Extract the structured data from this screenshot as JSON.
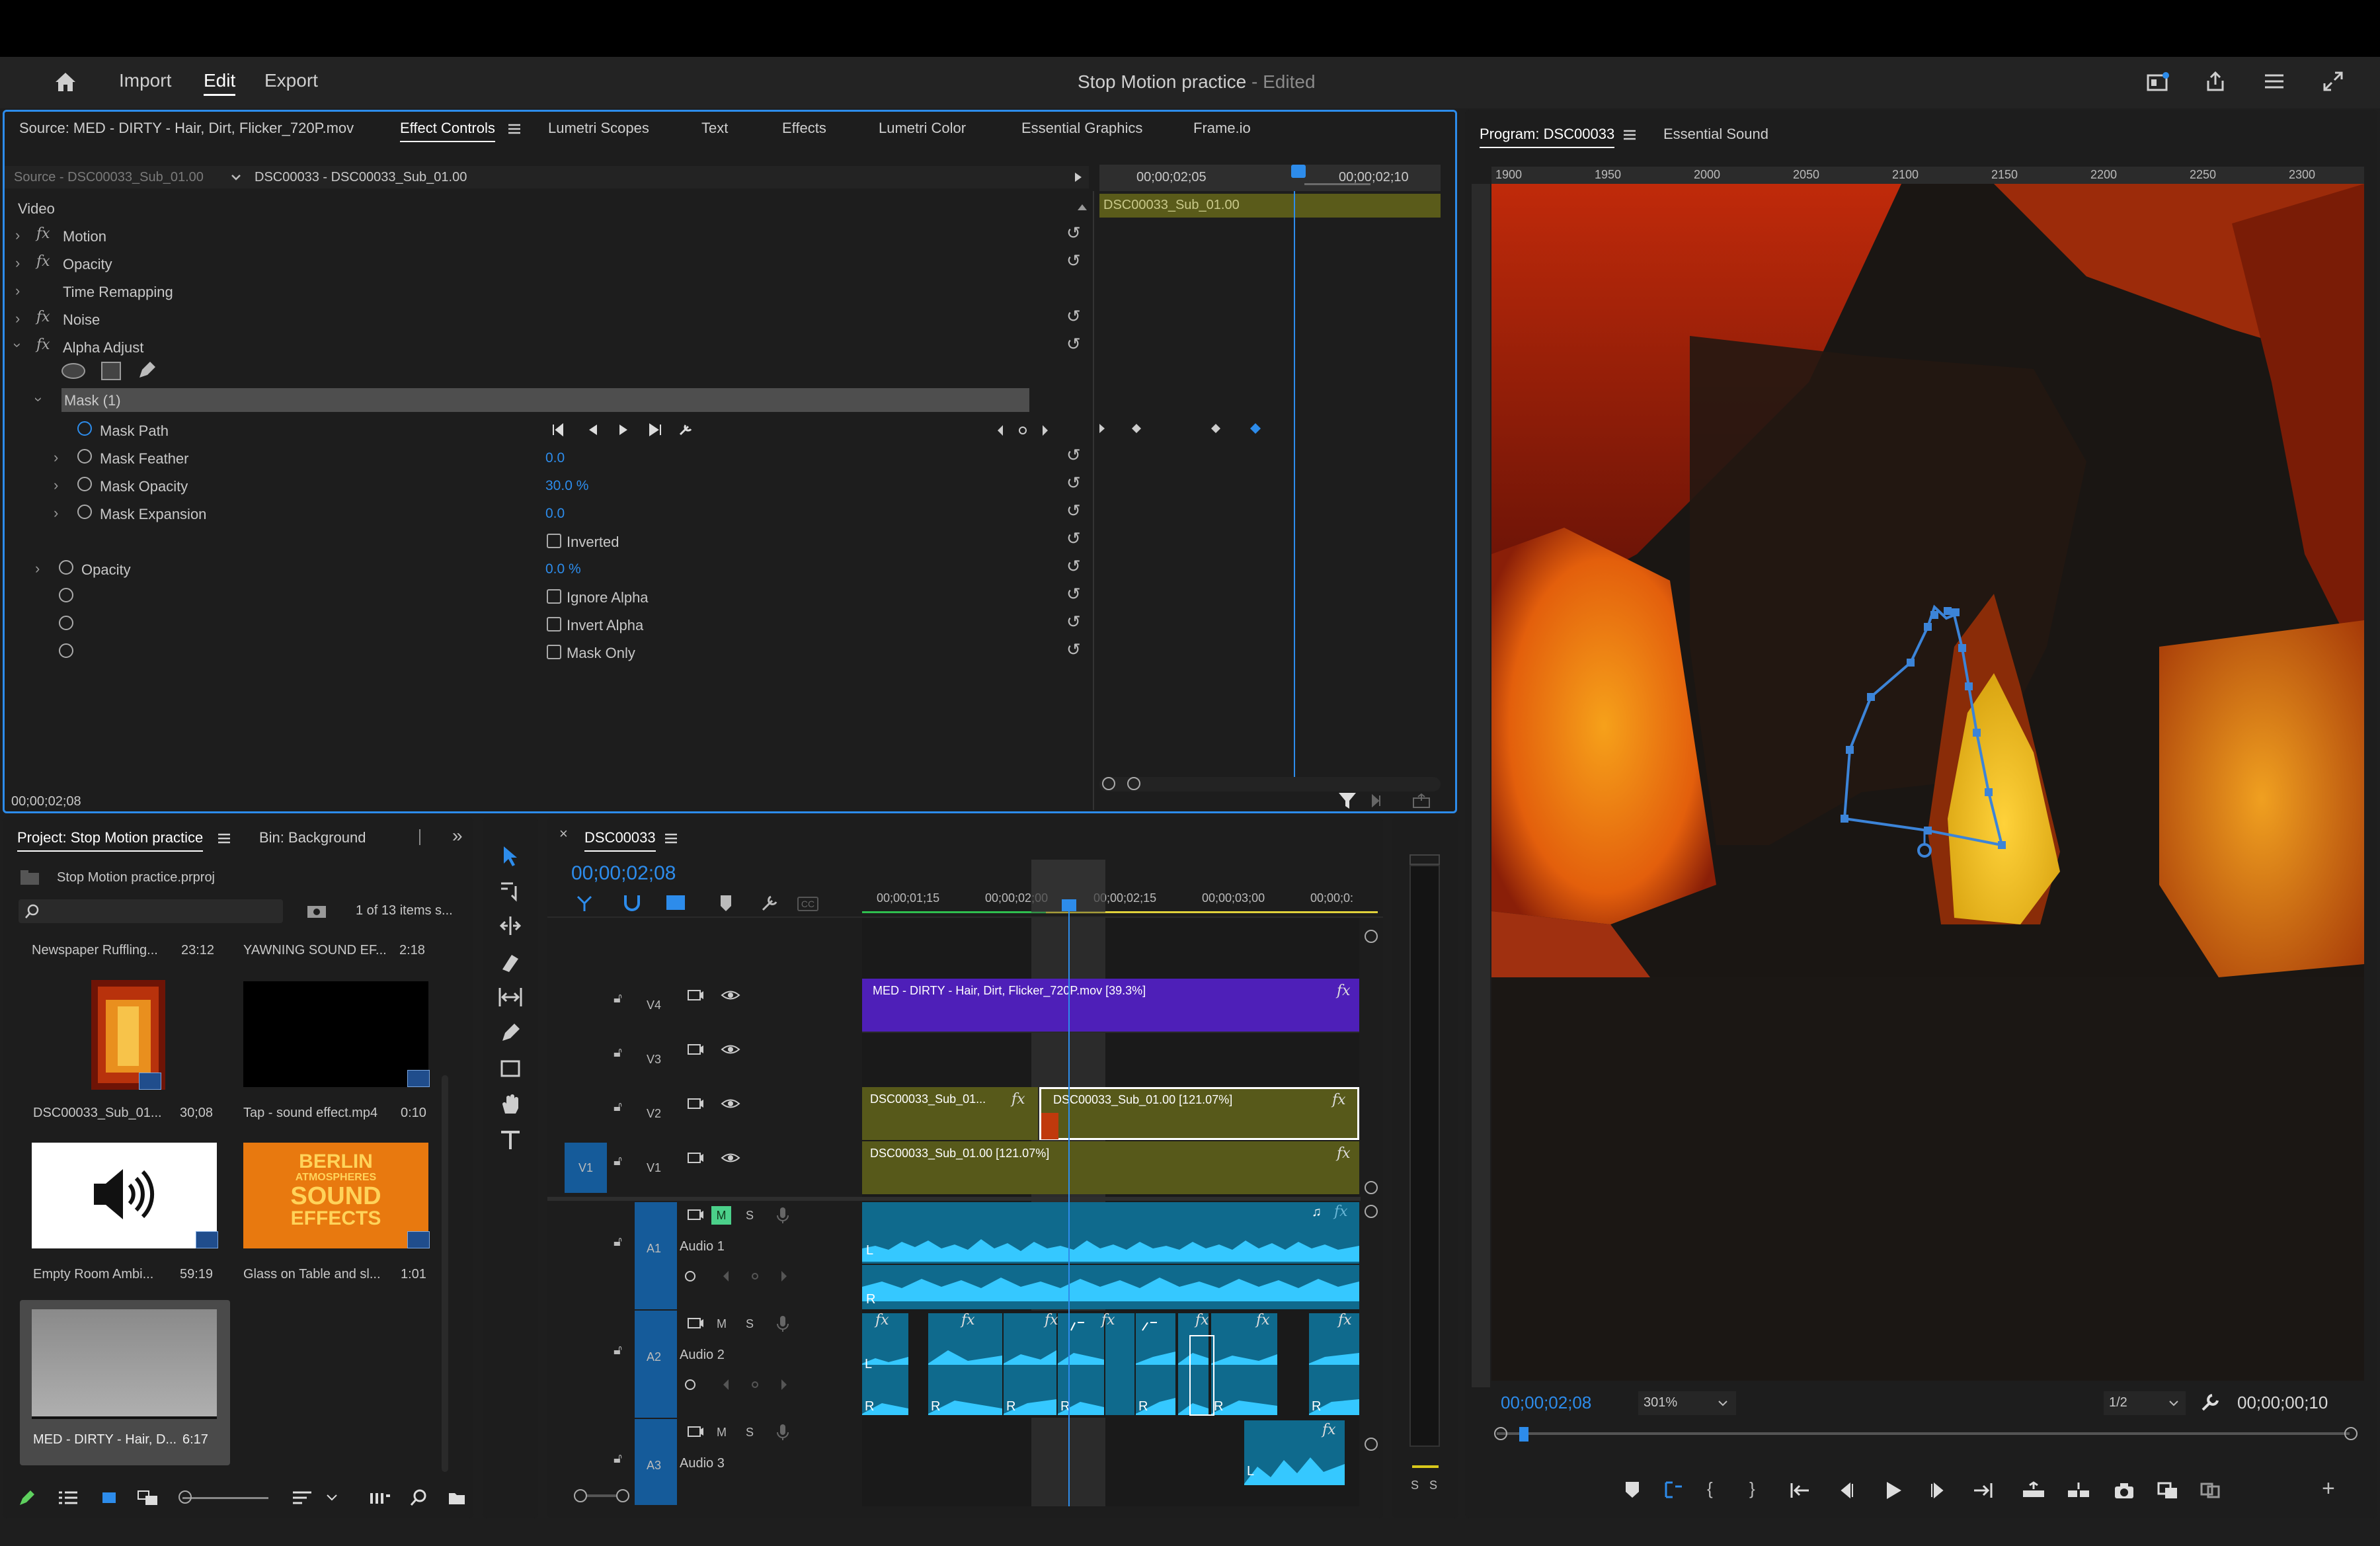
{
  "window": {
    "title": "Stop Motion practice",
    "title_status": "- Edited"
  },
  "menu": {
    "home_icon": "home-icon",
    "import": "Import",
    "edit": "Edit",
    "export": "Export"
  },
  "effect_panel": {
    "tabs": [
      "Source: MED - DIRTY - Hair, Dirt, Flicker_720P.mov",
      "Effect Controls",
      "Lumetri Scopes",
      "Text",
      "Effects",
      "Lumetri Color",
      "Essential Graphics",
      "Frame.io"
    ],
    "source_label": "Source - DSC00033_Sub_01.00",
    "sequence_clip": "DSC00033 - DSC00033_Sub_01.00",
    "mini_times": [
      "00;00;02;05",
      "00;00;02;10"
    ],
    "mini_clip": "DSC00033_Sub_01.00",
    "section": "Video",
    "effects": [
      "Motion",
      "Opacity",
      "Time Remapping",
      "Noise",
      "Alpha Adjust"
    ],
    "mask": "Mask (1)",
    "mask_rows": [
      {
        "label": "Mask Path",
        "value": ""
      },
      {
        "label": "Mask Feather",
        "value": "0.0"
      },
      {
        "label": "Mask Opacity",
        "value": "30.0 %"
      },
      {
        "label": "Mask Expansion",
        "value": "0.0"
      }
    ],
    "inverted": "Inverted",
    "opacity_label": "Opacity",
    "opacity_value": "0.0 %",
    "ignore_alpha": "Ignore Alpha",
    "invert_alpha": "Invert Alpha",
    "mask_only": "Mask Only",
    "timecode": "00;00;02;08"
  },
  "program": {
    "tabs": [
      "Program: DSC00033",
      "Essential Sound"
    ],
    "ruler": [
      "1900",
      "1950",
      "2000",
      "2050",
      "2100",
      "2150",
      "2200",
      "2250",
      "2300"
    ],
    "timecode": "00;00;02;08",
    "zoom": "301%",
    "resolution": "1/2",
    "duration": "00;00;00;10"
  },
  "project": {
    "tabs": [
      "Project: Stop Motion practice",
      "Bin: Background"
    ],
    "file": "Stop Motion practice.prproj",
    "items_count": "1 of 13 items s...",
    "top_items": [
      {
        "name": "Newspaper Ruffling...",
        "dur": "23:12"
      },
      {
        "name": "YAWNING SOUND EF...",
        "dur": "2:18"
      }
    ],
    "items": [
      {
        "name": "DSC00033_Sub_01...",
        "dur": "30;08"
      },
      {
        "name": "Tap - sound effect.mp4",
        "dur": "0:10"
      },
      {
        "name": "Empty Room Ambi...",
        "dur": "59:19"
      },
      {
        "name": "Glass on Table and sl...",
        "dur": "1:01"
      },
      {
        "name": "MED - DIRTY - Hair, D...",
        "dur": "6:17"
      }
    ],
    "thumb_text": {
      "l1": "BERLIN",
      "l2": "ATMOSPHERES",
      "l3": "SOUND",
      "l4": "EFFECTS"
    }
  },
  "timeline": {
    "sequence": "DSC00033",
    "timecode": "00;00;02;08",
    "ruler": [
      "00;00;01;15",
      "00;00;02;00",
      "00;00;02;15",
      "00;00;03;00",
      "00;00;0:"
    ],
    "tracks_v": [
      "V4",
      "V3",
      "V2",
      "V1"
    ],
    "tracks_a": [
      {
        "id": "A1",
        "name": "Audio 1"
      },
      {
        "id": "A2",
        "name": "Audio 2"
      },
      {
        "id": "A3",
        "name": "Audio 3"
      }
    ],
    "clips": {
      "v4": "MED - DIRTY - Hair, Dirt, Flicker_720P.mov [39.3%]",
      "v2a": "DSC00033_Sub_01...",
      "v2b": "DSC00033_Sub_01.00 [121.07%]",
      "v1": "DSC00033_Sub_01.00 [121.07%]"
    },
    "m": "M",
    "s": "S",
    "fx": "fx",
    "l": "L",
    "r": "R"
  },
  "meter": {
    "s1": "S",
    "s2": "S"
  },
  "colors": {
    "accent": "#2d8ceb",
    "video_purple": "#4e1fb8",
    "video_olive": "#57591a",
    "audio_blue": "#0f6a8d",
    "mask_blue": "#2f7bd3"
  }
}
